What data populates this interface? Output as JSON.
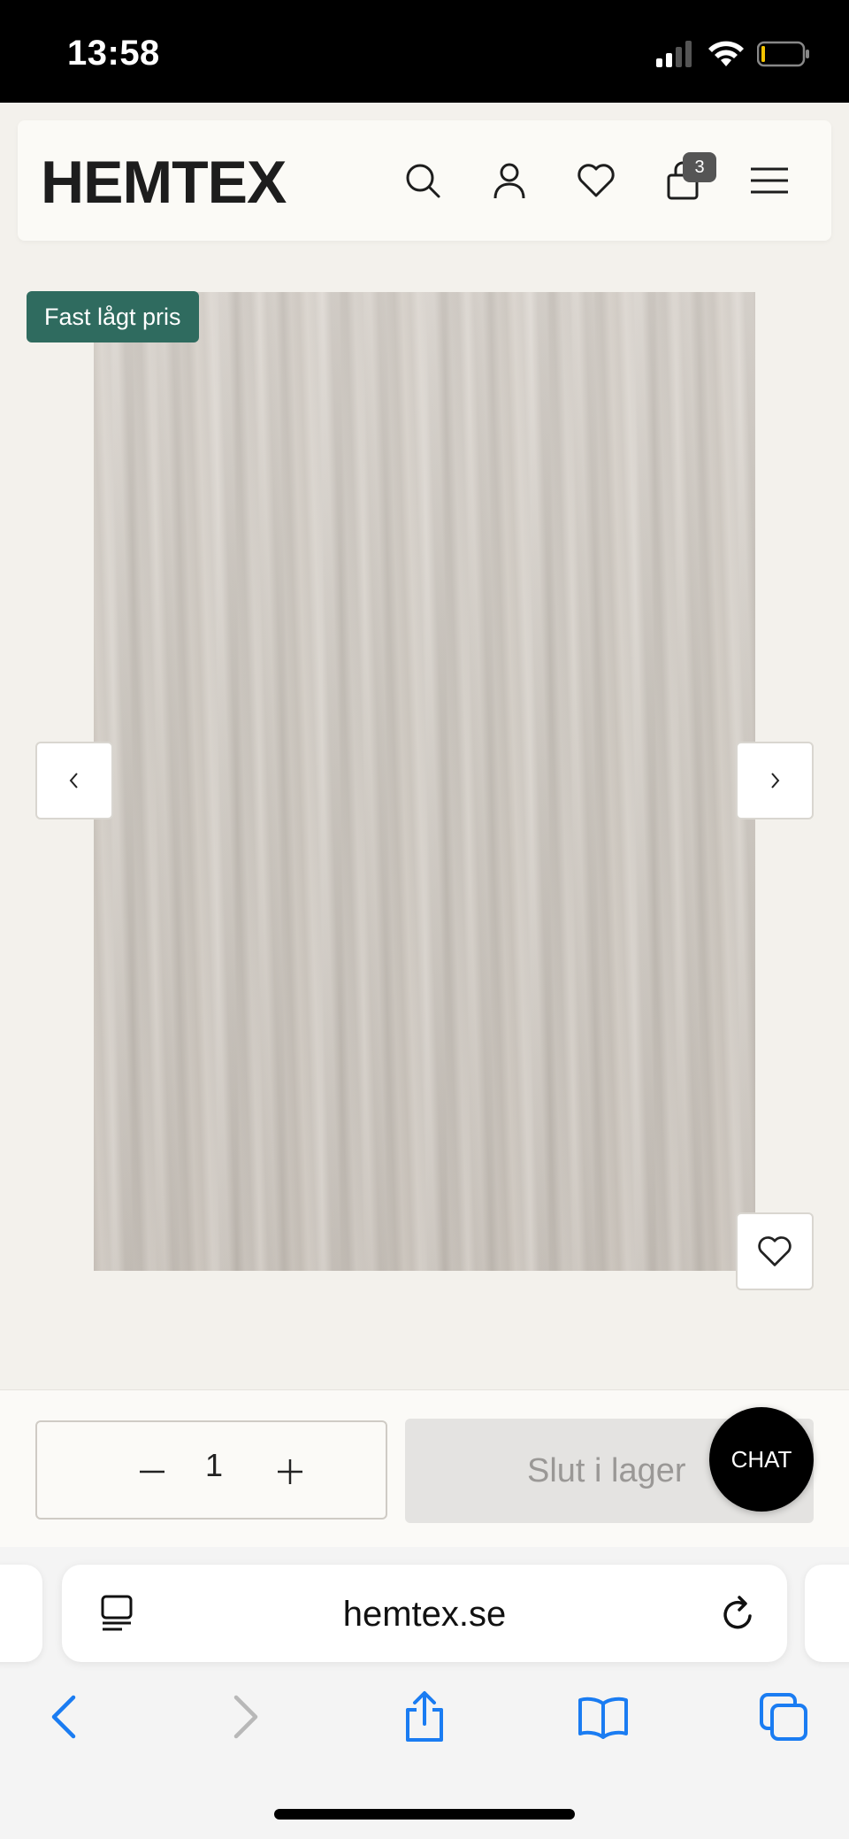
{
  "status_bar": {
    "time": "13:58"
  },
  "header": {
    "logo": "HEMTEX",
    "cart_count": "3",
    "icons": [
      "search-icon",
      "account-icon",
      "heart-icon",
      "cart-icon",
      "menu-icon"
    ]
  },
  "product": {
    "badge": "Fast lågt pris"
  },
  "purchase": {
    "quantity": "1",
    "cta_label": "Slut i lager",
    "chat_label": "CHAT"
  },
  "browser": {
    "url": "hemtex.se"
  },
  "colors": {
    "badge_bg": "#2f6b5f",
    "page_bg": "#f3f1ec",
    "ios_blue": "#1a7cf2"
  }
}
